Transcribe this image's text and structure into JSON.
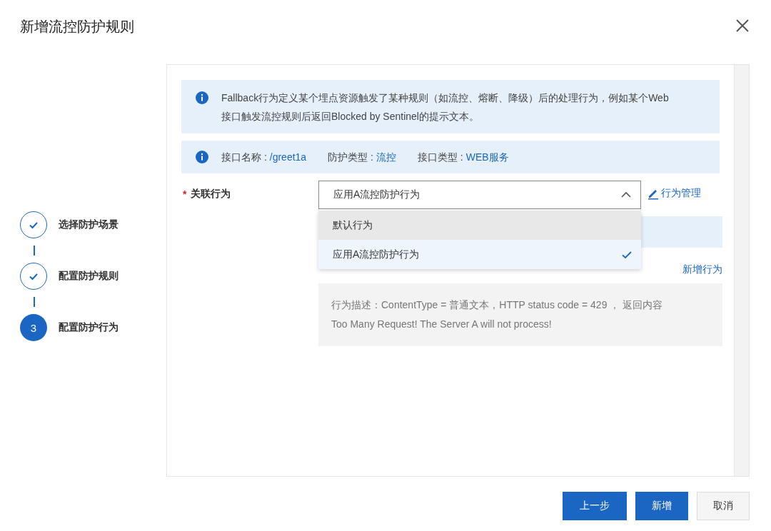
{
  "dialog": {
    "title": "新增流控防护规则"
  },
  "steps": [
    {
      "label": "选择防护场景",
      "completed": true
    },
    {
      "label": "配置防护规则",
      "completed": true
    },
    {
      "number": "3",
      "label": "配置防护行为",
      "completed": false
    }
  ],
  "notice": {
    "text": "Fallback行为定义某个埋点资源触发了某种规则（如流控、熔断、降级）后的处理行为，例如某个Web接口触发流控规则后返回Blocked by Sentinel的提示文本。"
  },
  "interface_info": [
    {
      "label": "接口名称 :",
      "value": "/greet1a"
    },
    {
      "label": "防护类型 :",
      "value": "流控"
    },
    {
      "label": "接口类型 :",
      "value": "WEB服务"
    }
  ],
  "form": {
    "label": "关联行为",
    "required_mark": "*",
    "select": {
      "value": "应用A流控防护行为",
      "expanded": true,
      "options": [
        {
          "label": "默认行为",
          "selected": false,
          "hovered": true
        },
        {
          "label": "应用A流控防护行为",
          "selected": true,
          "hovered": false
        }
      ]
    },
    "manage_link": "行为管理",
    "add_link": "新增行为",
    "description": [
      "行为描述：ContentType = 普通文本，HTTP status code = 429 ， 返回内容",
      "Too Many Request! The Server A will not process!"
    ]
  },
  "buttons": [
    {
      "label": "上一步",
      "kind": "primary"
    },
    {
      "label": "新增",
      "kind": "primary"
    },
    {
      "label": "取消",
      "kind": "default"
    }
  ]
}
